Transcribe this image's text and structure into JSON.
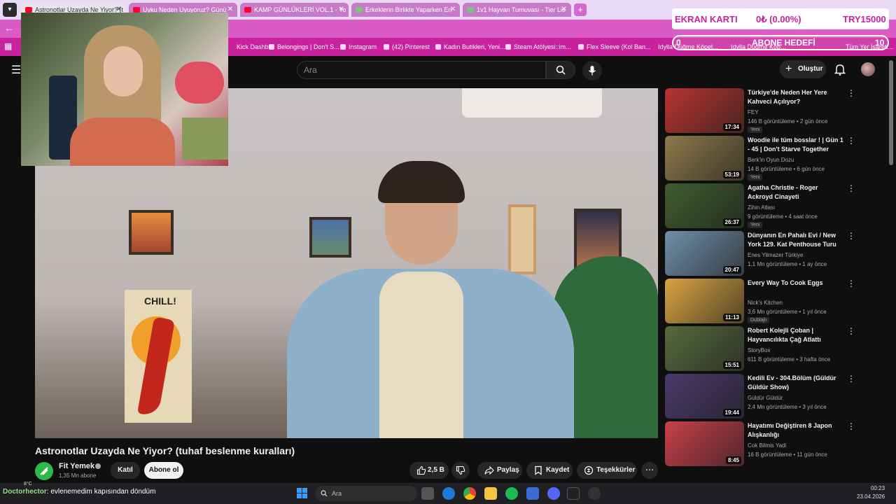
{
  "browser": {
    "tabs": [
      {
        "label": "Astronotlar Uzayda Ne Yiyor? (t",
        "active": true
      },
      {
        "label": "Uyku Neden Uyuyoruz? Günü",
        "active": false
      },
      {
        "label": "KAMP GÜNLÜKLERİ VOL.1 - Yo",
        "active": false
      },
      {
        "label": "Erkeklerin Birlikte Yaparken En",
        "active": false
      },
      {
        "label": "1v1 Hayvan Turnuvası - Tier Lis",
        "active": false
      }
    ],
    "new_tab_label": "+",
    "bookmarks": [
      "Kick Dashb...",
      "Belongings | Don't S...",
      "Instagram",
      "(42) Pinterest",
      "Kadın Butikleri, Yeni...",
      "Steam Atölyesi::im...",
      "Flex Sleeve (Kol Ban...",
      "Idylla Düğme Köpel...",
      "Idylla Düğme Köp...",
      "Tüm Yer İşaretl..."
    ]
  },
  "goal": {
    "left": "EKRAN KARTI",
    "middle": "0₺ (0.00%)",
    "right": "TRY15000",
    "bar_start": "0",
    "bar_label": "ABONE HEDEFİ",
    "bar_end": "10",
    "progress": 0
  },
  "youtube": {
    "search_placeholder": "Ara",
    "create_label": "Oluştur",
    "video": {
      "title": "Astronotlar Uzayda Ne Yiyor? (tuhaf beslenme kuralları)",
      "channel": "Fit Yemek",
      "subscribers": "1,35 Mn abone",
      "join_label": "Katıl",
      "subscribe_label": "Abone ol",
      "likes": "2,5 B",
      "share_label": "Paylaş",
      "save_label": "Kaydet",
      "thanks_label": "Teşekkürler",
      "poster_text": "CHILL!"
    },
    "recommendations": [
      {
        "title": "Türkiye'de Neden Her Yere Kahveci Açılıyor?",
        "channel": "FEY",
        "meta": "146 B görüntüleme • 2 gün önce",
        "badge": "Yeni",
        "duration": "17:34",
        "color": "#b8342f"
      },
      {
        "title": "Woodie ile tüm bosslar ! | Gün 1 - 45 | Don't Starve Together",
        "channel": "Berk'in Oyun Dozu",
        "meta": "14 B görüntüleme • 6 gün önce",
        "badge": "Yeni",
        "duration": "53:19",
        "color": "#8d7a4a"
      },
      {
        "title": "Agatha Christie  - Roger Ackroyd Cinayeti",
        "channel": "Zihin Atlası",
        "meta": "9 görüntüleme • 4 saat önce",
        "badge": "Yeni",
        "duration": "26:37",
        "color": "#3e5c2e"
      },
      {
        "title": "Dünyanın En Pahalı Evi / New York 129. Kat Penthouse Turu",
        "channel": "Enes Yilmazer Türkiye",
        "meta": "1,1 Mn görüntüleme • 1 ay önce",
        "badge": "",
        "duration": "20:47",
        "color": "#6f8fa8"
      },
      {
        "title": "Every Way To Cook Eggs",
        "channel": "Nick's Kitchen",
        "meta": "3,6 Mn görüntüleme • 1 yıl önce",
        "badge": "Dublajlı",
        "duration": "11:13",
        "color": "#d9a441"
      },
      {
        "title": "Robert Kolejli Çoban | Hayvancılıkta Çağ Atlattı",
        "channel": "StoryBox",
        "meta": "611 B görüntüleme • 3 hafta önce",
        "badge": "",
        "duration": "15:51",
        "color": "#556a3c"
      },
      {
        "title": "Kedili Ev - 304.Bölüm (Güldür Güldür Show)",
        "channel": "Güldür Güldür",
        "meta": "2,4 Mn görüntüleme • 3 yıl önce",
        "badge": "",
        "duration": "19:44",
        "color": "#4a3a6a"
      },
      {
        "title": "Hayatımı Değiştiren 8 Japon Alışkanlığı",
        "channel": "Cok Bilmis Yadi",
        "meta": "16 B görüntüleme • 11 gün önce",
        "badge": "",
        "duration": "8:45",
        "color": "#c9404a"
      }
    ]
  },
  "taskbar": {
    "chat_user": "Doctorhector",
    "chat_message": ": evlenemedim kapısından döndüm",
    "weather": "8°C",
    "search_placeholder": "Ara",
    "time": "00:23",
    "date": "23.04.2026"
  },
  "colors": {
    "accent_pink": "#c8229e",
    "youtube_red": "#ff0033",
    "bg": "#0f0f0f"
  }
}
